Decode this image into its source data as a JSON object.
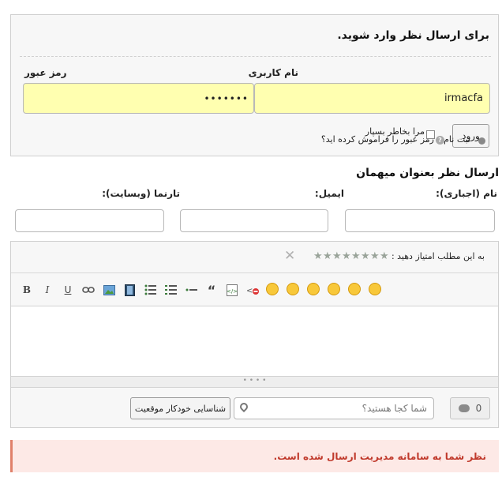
{
  "login": {
    "heading": "برای ارسال نظر وارد شوید.",
    "username_label": "نام کاربری",
    "username_value": "irmacfa",
    "password_label": "رمز عبور",
    "password_value": "•••••••",
    "remember_label": "مرا بخاطر بسپار",
    "forgot_label": "رمز عبور را فراموش کرده اید؟",
    "register_label": "ثبت نام",
    "login_button": "ورود"
  },
  "guest": {
    "heading": "ارسال نظر بعنوان میهمان",
    "name_label": "نام (اجباری):",
    "email_label": "ایمیل:",
    "website_label": "تارنما (وبسایت):"
  },
  "rating": {
    "label": "به این مطلب امتیاز دهید :",
    "max_stars": 8,
    "value": 0
  },
  "toolbar": {
    "bold": "B",
    "italic": "I",
    "underline": "U",
    "quote": "“"
  },
  "location": {
    "placeholder": "شما کجا هستید؟",
    "auto_button": "شناسایی خودکار موقعیت",
    "comment_count": "0"
  },
  "notice": {
    "text": "نظر شما به سامانه مدیریت ارسال شده است."
  },
  "colors": {
    "input_fill": "#ffffb0",
    "notice_bg": "#fde9e6",
    "notice_text": "#c0392b"
  }
}
